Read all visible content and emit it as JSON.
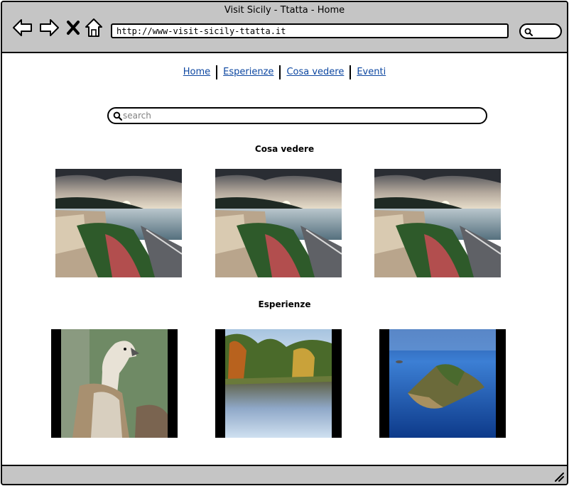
{
  "window": {
    "title": "Visit Sicily - Ttatta - Home"
  },
  "browser": {
    "url": "http://www-visit-sicily-ttatta.it",
    "icons": [
      "back-arrow-icon",
      "forward-arrow-icon",
      "close-x-icon",
      "home-icon",
      "search-icon"
    ]
  },
  "nav": {
    "items": [
      {
        "label": "Home"
      },
      {
        "label": "Esperienze"
      },
      {
        "label": "Cosa vedere"
      },
      {
        "label": "Eventi"
      }
    ]
  },
  "search": {
    "placeholder": "search"
  },
  "sections": {
    "cosa_vedere": {
      "title": "Cosa vedere",
      "photos": [
        "coastal-town-sunset-photo",
        "coastal-town-sunset-photo",
        "coastal-town-sunset-photo"
      ]
    },
    "esperienze": {
      "title": "Esperienze",
      "photos": [
        "vulture-bird-photo",
        "autumn-lake-photo",
        "island-aerial-photo"
      ]
    }
  },
  "colors": {
    "chrome": "#c5c5c5",
    "link": "#0d47a1",
    "border": "#000000"
  }
}
